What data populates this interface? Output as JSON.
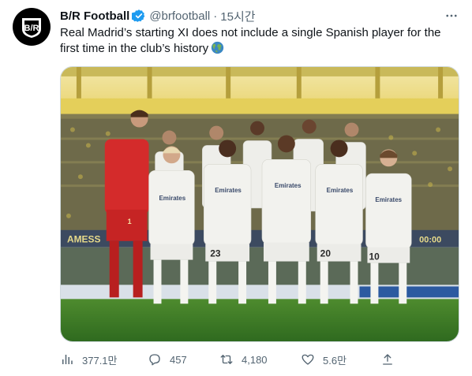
{
  "tweet": {
    "author_name": "B/R Football",
    "handle": "@brfootball",
    "separator": "·",
    "time": "15시간",
    "text": "Real Madrid’s starting XI does not include a single Spanish player for the first time in the club’s history",
    "text_emoji": "globe-emoji"
  },
  "media": {
    "stadium_banner_left": "AMESS",
    "stadium_banner_right": "00:00",
    "jerseys": [
      "Emirates",
      "Emirates",
      "Emirates",
      "Emirates",
      "Emirates",
      "Emirates"
    ],
    "numbers": [
      "23",
      "20",
      "10",
      "1"
    ]
  },
  "actions": {
    "views": "377.1만",
    "replies": "457",
    "retweets": "4,180",
    "likes": "5.6만"
  },
  "colors": {
    "text_primary": "#0f1419",
    "text_secondary": "#536471",
    "verified": "#1d9bf0",
    "border": "#cfd9de"
  }
}
